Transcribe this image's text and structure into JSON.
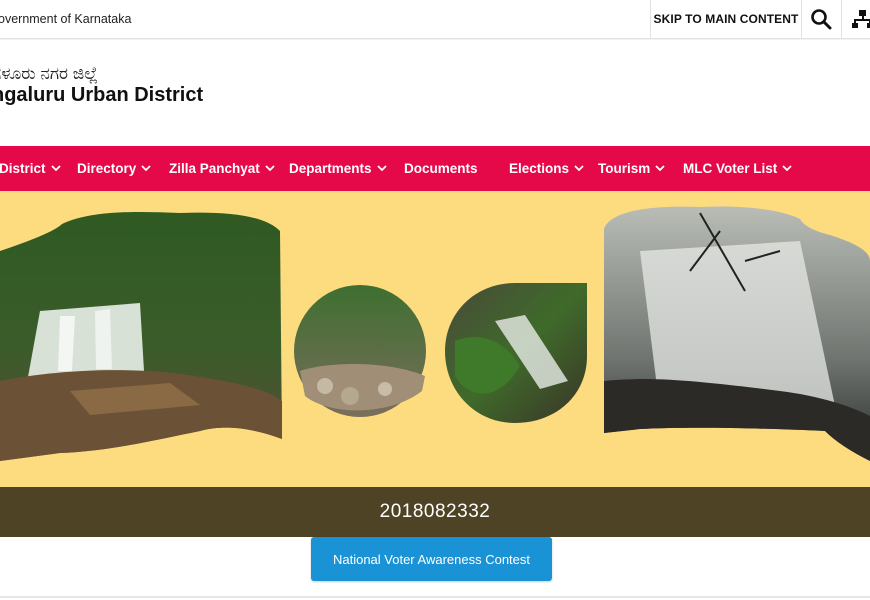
{
  "topbar": {
    "govt_label": "overnment of Karnataka",
    "skip_label": "SKIP TO MAIN CONTENT",
    "search_icon": "search-icon",
    "sitemap_icon": "sitemap-icon"
  },
  "header": {
    "title_kannada": "ಗಳೂರು ನಗರ ಜಿಲ್ಲೆ",
    "title_english": "ngaluru Urban District"
  },
  "nav": {
    "items": [
      {
        "label": "District",
        "has_dropdown": true
      },
      {
        "label": "Directory",
        "has_dropdown": true
      },
      {
        "label": "Zilla Panchyat",
        "has_dropdown": true
      },
      {
        "label": "Departments",
        "has_dropdown": true
      },
      {
        "label": "Documents",
        "has_dropdown": false
      },
      {
        "label": "Elections",
        "has_dropdown": true
      },
      {
        "label": "Tourism",
        "has_dropdown": true
      },
      {
        "label": "MLC Voter List",
        "has_dropdown": true
      }
    ],
    "chevron": "⌄"
  },
  "counter": {
    "value": "2018082332"
  },
  "cta": {
    "label": "National Voter Awareness Contest"
  },
  "colors": {
    "nav_bg": "#e5094a",
    "banner_bg": "#fddc80",
    "counter_bg": "#4e4324",
    "cta_bg": "#1a93d6"
  }
}
